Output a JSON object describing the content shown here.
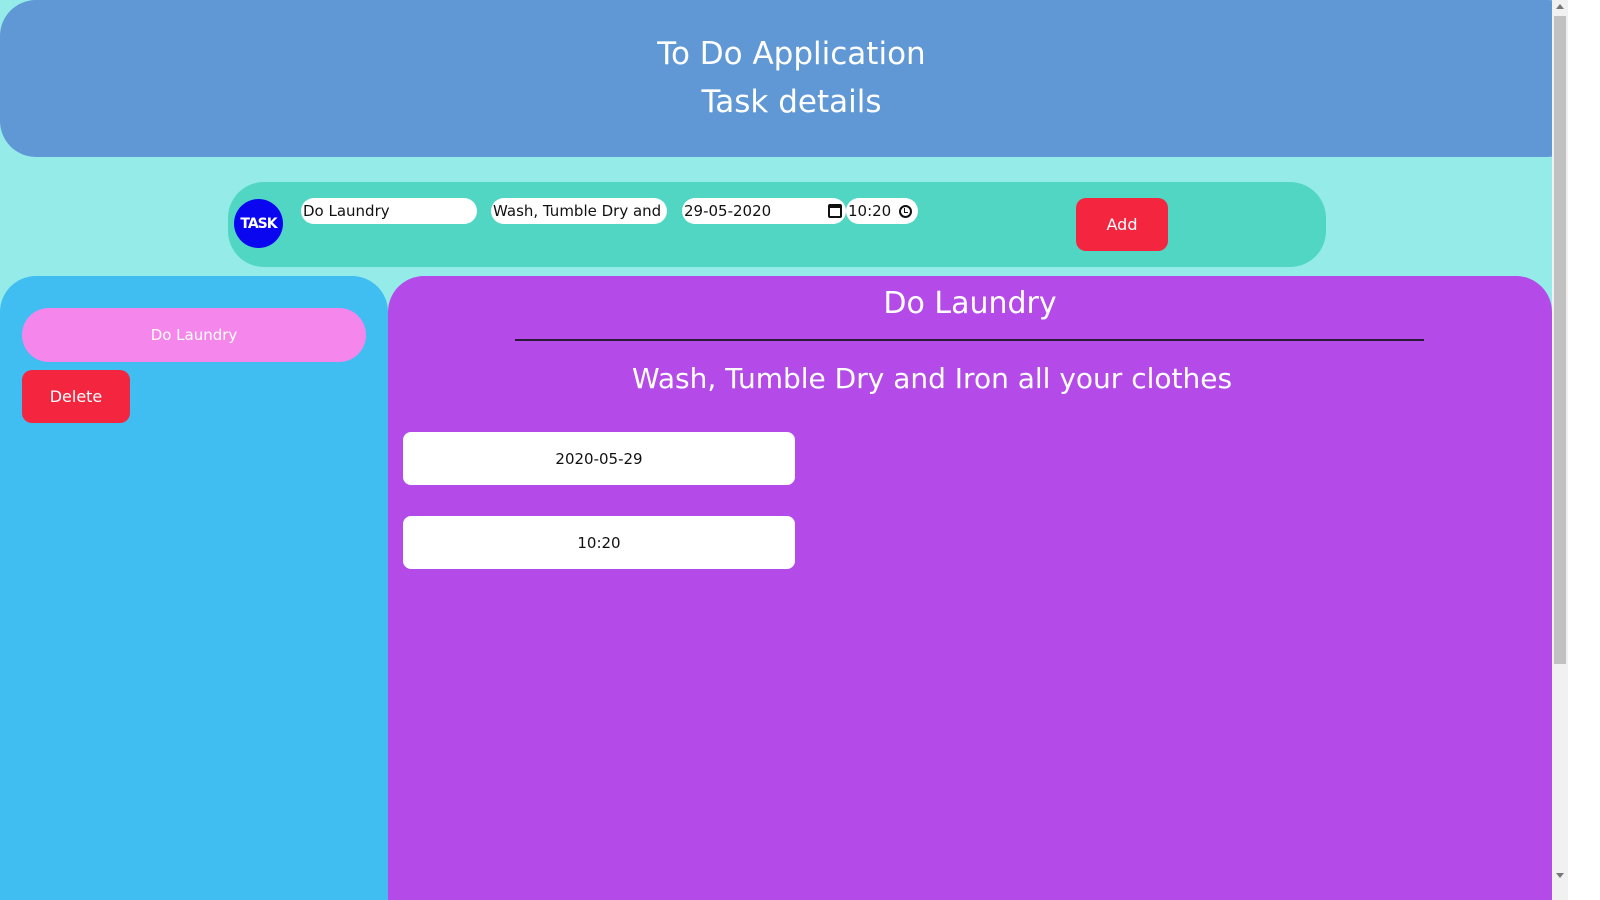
{
  "header": {
    "title": "To Do Application",
    "subtitle": "Task details"
  },
  "form": {
    "logo_text": "TASK",
    "task_name_value": "Do Laundry",
    "task_description_value": "Wash, Tumble Dry and Ir",
    "date_value": "29-05-2020",
    "time_value": "10:20",
    "add_label": "Add"
  },
  "sidebar": {
    "tasks": [
      {
        "label": "Do Laundry"
      }
    ],
    "delete_label": "Delete"
  },
  "details": {
    "title": "Do Laundry",
    "description": "Wash, Tumble Dry and Iron all your clothes",
    "date": "2020-05-29",
    "time": "10:20"
  },
  "colors": {
    "header_bg": "#6098d6",
    "page_bg": "#94ebe8",
    "form_bg": "#50d6c2",
    "sidebar_bg": "#40bef2",
    "details_bg": "#b44be8",
    "task_pill_bg": "#f587ec",
    "button_red": "#f4263f",
    "logo_blue": "#0a07f0"
  }
}
